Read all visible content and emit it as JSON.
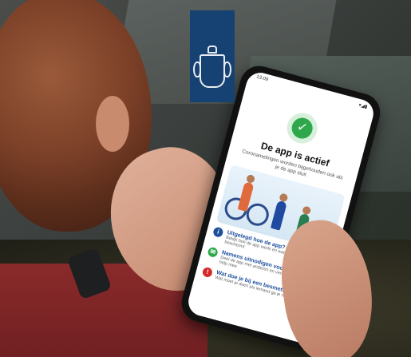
{
  "scene": {
    "description": "photo-person-using-phone-app",
    "colors": {
      "logo_blue": "#154273",
      "success_green": "#2ea84a",
      "sweater_red": "#8a2a2a"
    }
  },
  "phone": {
    "status_time": "13:09",
    "status_icons": "▾◢▮",
    "check_icon": "✓",
    "title": "De app is actief",
    "subtitle": "Coronamelingen worden bijgehouden ook als je de app sluit",
    "items": [
      {
        "icon": "info-icon",
        "title": "Uitgelegd hoe de app?",
        "desc": "Bekijk hoe de app werkt en wat de app je privacy beschermt"
      },
      {
        "icon": "chat-icon",
        "title": "Namens uitnodigen voor de app",
        "desc": "Deel de app met anderen en verspreid zo de app en help mee"
      },
      {
        "icon": "warning-icon",
        "title": "Wat doe je bij een besmetting?",
        "desc": "Wat moet je doen als iemand ga je naar een test"
      }
    ]
  },
  "logo": {
    "name": "rijksoverheid-logo"
  }
}
